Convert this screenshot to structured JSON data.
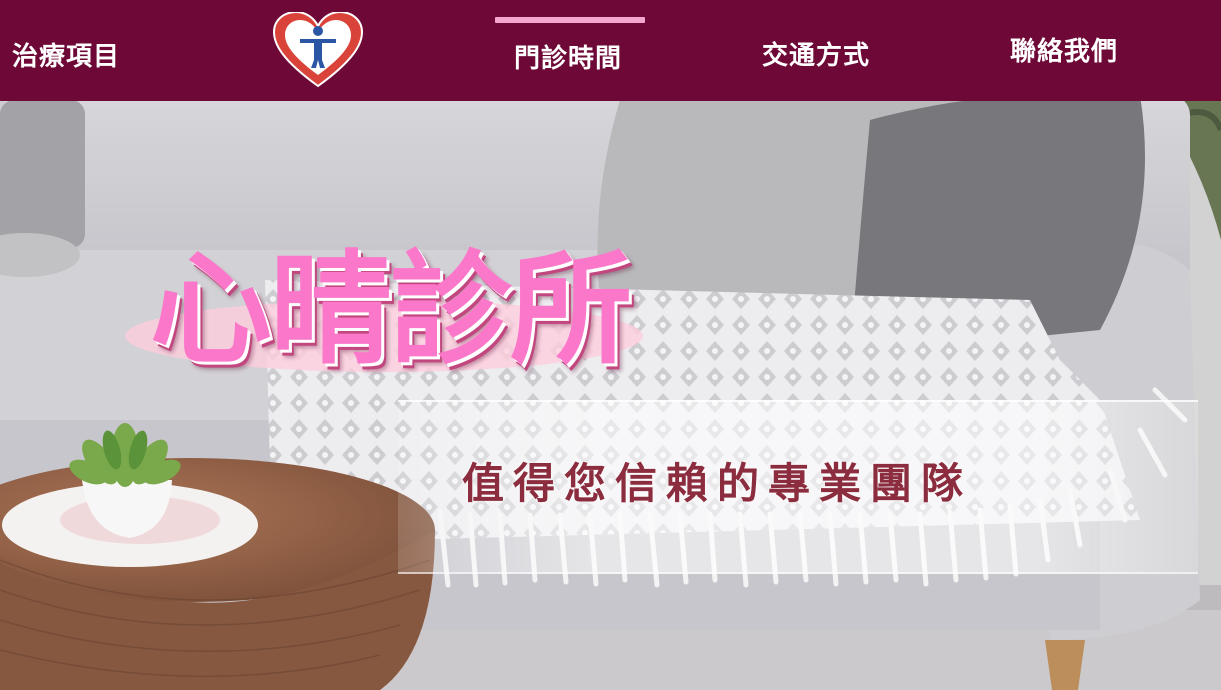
{
  "nav": {
    "items": [
      {
        "label": "治療項目"
      },
      {
        "label": "門診時間"
      },
      {
        "label": "交通方式"
      },
      {
        "label": "聯絡我們"
      }
    ],
    "active_index": 1,
    "logo_icon": "heart-person-logo-icon"
  },
  "hero": {
    "title": "心晴診所",
    "tagline": "值得您信賴的專業團隊"
  },
  "colors": {
    "nav_bg": "#6e0837",
    "active_indicator": "#f5a6cf",
    "title_pink": "#fb77c9",
    "tagline": "#8c2d3f"
  }
}
